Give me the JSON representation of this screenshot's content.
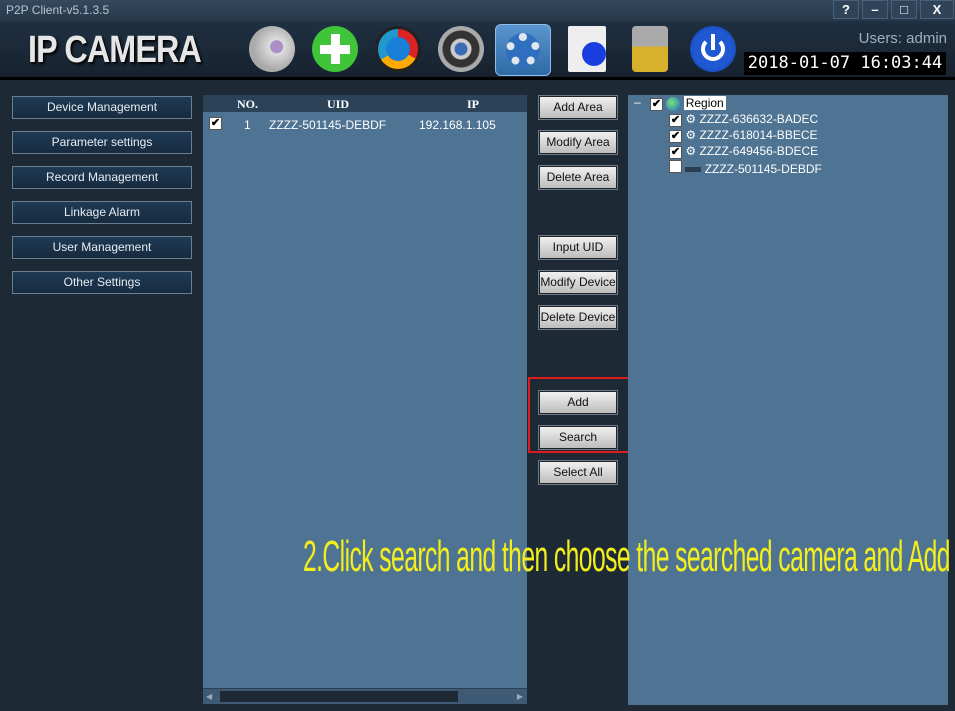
{
  "window": {
    "title": "P2P Client-v5.1.3.5",
    "controls": [
      "?",
      "–",
      "□",
      "X"
    ]
  },
  "header": {
    "logo": "IP CAMERA",
    "users": "Users: admin",
    "datetime": "2018-01-07 16:03:44",
    "toolbar": [
      "camera-view",
      "add",
      "playback",
      "ptz",
      "settings",
      "log",
      "lock",
      "power"
    ],
    "active": "settings"
  },
  "sidebar": {
    "items": [
      {
        "label": "Device Management"
      },
      {
        "label": "Parameter settings"
      },
      {
        "label": "Record Management"
      },
      {
        "label": "Linkage Alarm"
      },
      {
        "label": "User Management"
      },
      {
        "label": "Other Settings"
      }
    ]
  },
  "table": {
    "columns": [
      "NO.",
      "UID",
      "IP"
    ],
    "rows": [
      {
        "checked": true,
        "no": "1",
        "uid": "ZZZZ-501145-DEBDF",
        "ip": "192.168.1.105"
      }
    ]
  },
  "buttons": {
    "add_area": "Add Area",
    "modify_area": "Modify Area",
    "delete_area": "Delete Area",
    "input_uid": "Input UID",
    "modify_device": "Modify Device",
    "delete_device": "Delete Device",
    "add": "Add",
    "search": "Search",
    "select_all": "Select All"
  },
  "tree": {
    "root": {
      "label": "Region",
      "checked": true,
      "expander": "–"
    },
    "children": [
      {
        "label": "ZZZZ-636632-BADEC",
        "checked": true
      },
      {
        "label": "ZZZZ-618014-BBECE",
        "checked": true
      },
      {
        "label": "ZZZZ-649456-BDECE",
        "checked": true
      },
      {
        "label": "ZZZZ-501145-DEBDF",
        "checked": false
      }
    ]
  },
  "annotation": {
    "text": "2.Click search and then choose the searched camera and Add",
    "color": "#f2ef1c",
    "highlight_color": "#e01b1b"
  }
}
